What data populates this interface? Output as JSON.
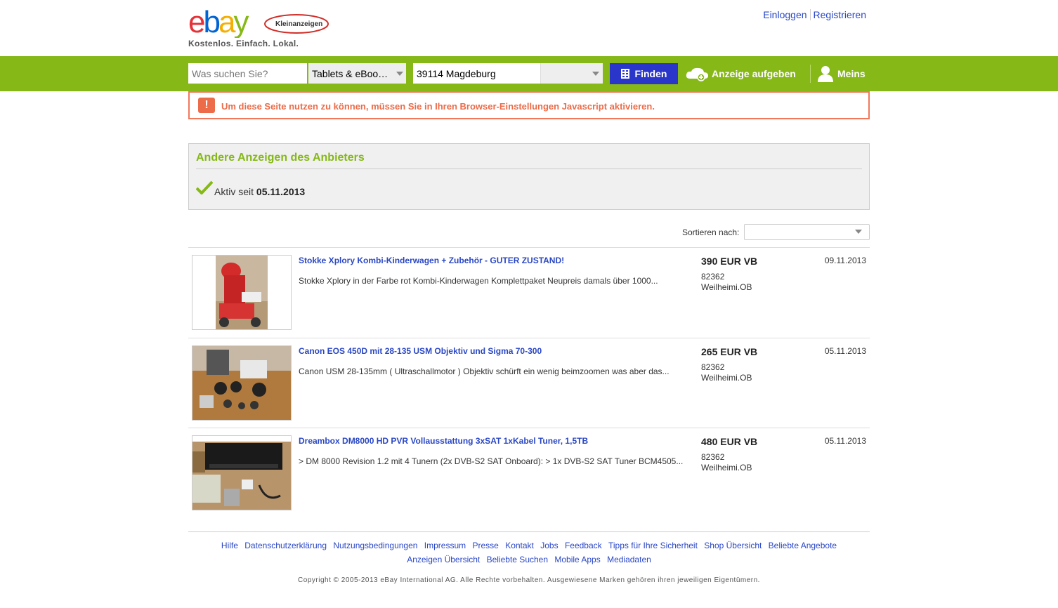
{
  "header": {
    "logo_text": "ebay",
    "logo_badge": "Kleinanzeigen",
    "tagline": "Kostenlos. Einfach. Lokal.",
    "login": "Einloggen",
    "register": "Registrieren"
  },
  "nav": {
    "search_placeholder": "Was suchen Sie?",
    "category": "Tablets & eBoo…",
    "location": "39114 Magdeburg",
    "radius": "",
    "find_label": "Finden",
    "post_ad": "Anzeige aufgeben",
    "mine": "Meins"
  },
  "alert": {
    "message": "Um diese Seite nutzen zu können, müssen Sie in Ihren Browser-Einstellungen Javascript aktivieren."
  },
  "seller": {
    "heading": "Andere Anzeigen des Anbieters",
    "active_label": "Aktiv seit",
    "active_since": "05.11.2013"
  },
  "sort": {
    "label": "Sortieren nach:",
    "selected": ""
  },
  "listings": [
    {
      "title": "Stokke Xplory Kombi-Kinderwagen + Zubehör - GUTER ZUSTAND!",
      "description": "Stokke Xplory in der Farbe rot Kombi-Kinderwagen Komplettpaket Neupreis damals über 1000...",
      "price": "390 EUR VB",
      "zip": "82362",
      "city": "Weilheimi.OB",
      "date": "09.11.2013"
    },
    {
      "title": "Canon EOS 450D mit 28-135 USM Objektiv und Sigma 70-300",
      "description": "Canon USM 28-135mm ( Ultraschallmotor ) Objektiv schürft ein wenig beimzoomen was aber das...",
      "price": "265 EUR VB",
      "zip": "82362",
      "city": "Weilheimi.OB",
      "date": "05.11.2013"
    },
    {
      "title": "Dreambox DM8000 HD PVR Vollausstattung 3xSAT 1xKabel Tuner, 1,5TB",
      "description": "> DM 8000 Revision 1.2 mit 4 Tunern (2x DVB-S2 SAT Onboard): > 1x DVB-S2 SAT Tuner BCM4505...",
      "price": "480 EUR VB",
      "zip": "82362",
      "city": "Weilheimi.OB",
      "date": "05.11.2013"
    }
  ],
  "footer": {
    "links_row1": [
      "Hilfe",
      "Datenschutzerklärung",
      "Nutzungsbedingungen",
      "Impressum",
      "Presse",
      "Kontakt",
      "Jobs",
      "Feedback",
      "Tipps für Ihre Sicherheit",
      "Shop Übersicht",
      "Beliebte Angebote"
    ],
    "links_row2": [
      "Anzeigen Übersicht",
      "Beliebte Suchen",
      "Mobile Apps",
      "Mediadaten"
    ],
    "copyright": "Copyright © 2005-2013 eBay International AG. Alle Rechte vorbehalten. Ausgewiesene Marken gehören ihren jeweiligen Eigentümern."
  }
}
